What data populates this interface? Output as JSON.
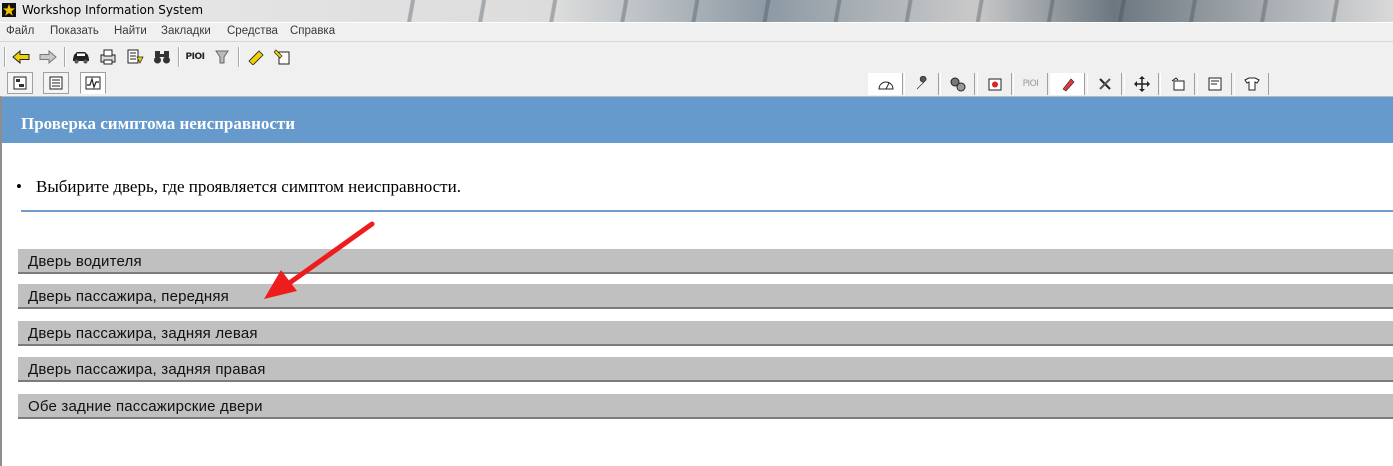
{
  "window": {
    "title": "Workshop Information System"
  },
  "menu": {
    "items": [
      "Файл",
      "Показать",
      "Найти",
      "Закладки",
      "Средства",
      "Справка"
    ]
  },
  "toolbar": {
    "pioi_label": "PIOI",
    "pioi_label_right": "PIOI"
  },
  "page": {
    "heading": "Проверка симптома неисправности",
    "instruction": "Выбирите дверь, где проявляется симптом неисправности.",
    "options": [
      "Дверь водителя",
      "Дверь пассажира, передняя",
      "Дверь пассажира, задняя левая",
      "Дверь пассажира, задняя правая",
      "Обе задние пассажирские двери"
    ]
  },
  "annotation": {
    "arrow_color": "#ee1c1c",
    "points_to": "Дверь пассажира, передняя"
  },
  "colors": {
    "header_band": "#6699cc",
    "option_bg": "#c0c0c0"
  }
}
